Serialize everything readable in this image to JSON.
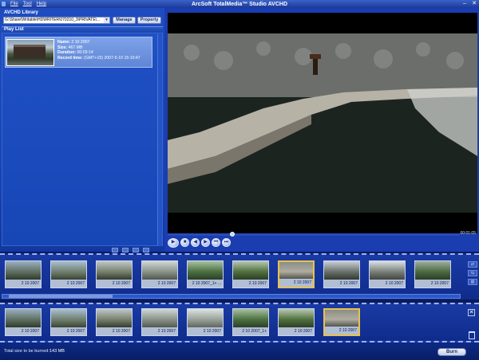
{
  "window": {
    "title": "ArcSoft TotalMedia™ Studio AVCHD",
    "menu": [
      "File",
      "Tool",
      "Help"
    ]
  },
  "library": {
    "label": "AVCHD Library",
    "path": "G:\\Share\\Writable\\HDWRITER\\070210_3\\PRIVATE\\...",
    "manage_label": "Manage",
    "property_label": "Property"
  },
  "playlist": {
    "header": "Play List",
    "item": {
      "name_label": "Name:",
      "name": "2 10 2007",
      "size_label": "Size:",
      "size": "467 MB",
      "duration_label": "Duration:",
      "duration": "00:03:14",
      "record_label": "Record time:",
      "record": "(GMT+15) 2007-5-10 15:10:47"
    }
  },
  "player": {
    "timecode": "00:01:05",
    "progress": 0.22
  },
  "top_strip": [
    "2 10 2007",
    "2 10 2007",
    "2 10 2007",
    "2 10 2007",
    "2 10 2007_1+ ...",
    "2 10 2007",
    "2 10 2007",
    "2 10 2007",
    "2 10 2007",
    "2 10 2007"
  ],
  "bottom_strip": [
    "2 10 2007",
    "2 10 2007",
    "2 10 2007",
    "2 10 2007",
    "2 10 2007",
    "2 10 2007_1+",
    "2 10 2007",
    "2 10 2007"
  ],
  "status": {
    "label": "Total size to be burned:",
    "value": "143 MB",
    "burn_label": "Burn"
  },
  "colors": {
    "accent": "#1e4cc0",
    "selected": "#e8c24a"
  }
}
